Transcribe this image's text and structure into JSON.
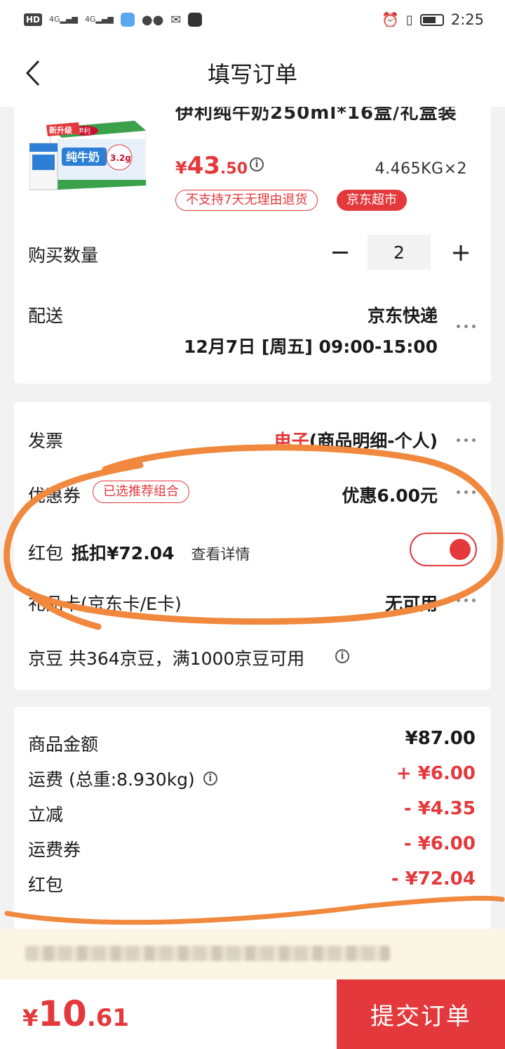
{
  "status_bar": {
    "hd": "HD",
    "signal1": "4G",
    "signal2": "4G",
    "time": "2:25"
  },
  "nav": {
    "title": "填写订单"
  },
  "product": {
    "title_cut": "伊利纯牛奶250ml*16盒/礼盒装",
    "price_yen": "¥",
    "price_int": "43",
    "price_dec": ".50",
    "weight": "4.465KG×2",
    "tag_no_return": "不支持7天无理由退货",
    "tag_store": "京东超市",
    "image_label_new": "新升级",
    "image_label_brand": "伊利",
    "image_label_name": "纯牛奶",
    "image_label_protein": "3.2g"
  },
  "quantity": {
    "label": "购买数量",
    "value": "2"
  },
  "delivery": {
    "label": "配送",
    "carrier": "京东快递",
    "time": "12月7日 [周五] 09:00-15:00"
  },
  "invoice": {
    "label": "发票",
    "type_red": "电子",
    "type_rest": "(商品明细-个人)"
  },
  "coupon": {
    "label": "优惠券",
    "chip": "已选推荐组合",
    "value": "优惠6.00元"
  },
  "red_packet": {
    "label": "红包",
    "deduct": "抵扣¥72.04",
    "detail": "查看详情",
    "enabled": true
  },
  "gift_card": {
    "label": "礼品卡(京东卡/E卡)",
    "value": "无可用"
  },
  "jd_beans": {
    "label": "京豆 共364京豆，满1000京豆可用"
  },
  "summary": {
    "items": [
      {
        "label": "商品金额",
        "value": "¥87.00",
        "color": "black"
      },
      {
        "label": "运费 (总重:8.930kg)",
        "value": "+ ¥6.00",
        "color": "red"
      },
      {
        "label": "立减",
        "value": "- ¥4.35",
        "color": "red"
      },
      {
        "label": "运费券",
        "value": "- ¥6.00",
        "color": "red"
      },
      {
        "label": "红包",
        "value": "- ¥72.04",
        "color": "red"
      }
    ]
  },
  "footer": {
    "total_yen": "¥",
    "total_int": "10",
    "total_dec": ".61",
    "submit": "提交订单"
  },
  "colors": {
    "accent": "#e4393c",
    "annotation": "#f0883e"
  }
}
